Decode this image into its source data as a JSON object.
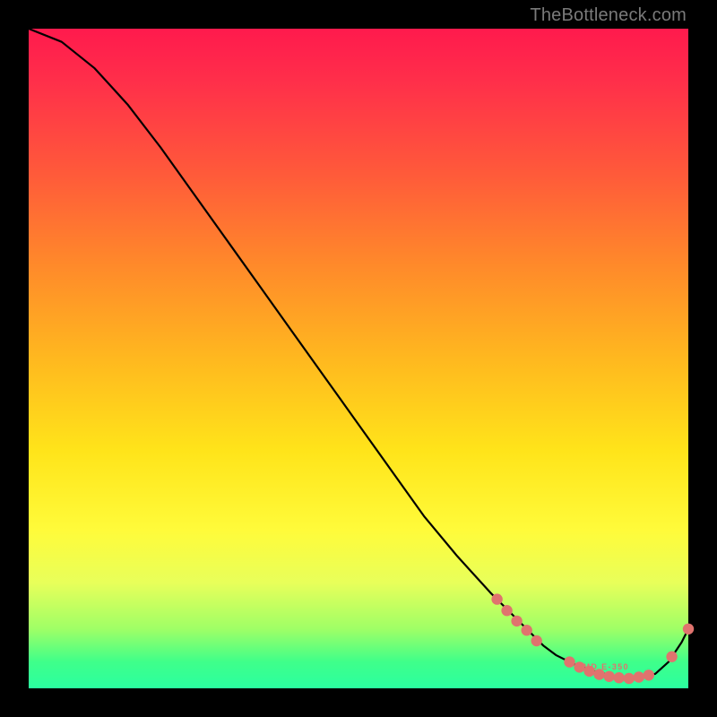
{
  "watermark": "TheBottleneck.com",
  "annotation_label": "AMD E-350",
  "chart_data": {
    "type": "line",
    "title": "",
    "xlabel": "",
    "ylabel": "",
    "xlim": [
      0,
      100
    ],
    "ylim": [
      0,
      100
    ],
    "series": [
      {
        "name": "bottleneck-curve",
        "x": [
          0,
          5,
          10,
          15,
          20,
          25,
          30,
          35,
          40,
          45,
          50,
          55,
          60,
          65,
          70,
          75,
          78,
          80,
          83,
          86,
          89,
          92,
          95,
          97,
          99,
          100
        ],
        "y": [
          100,
          98,
          94,
          88.5,
          82,
          75,
          68,
          61,
          54,
          47,
          40,
          33,
          26,
          20,
          14.5,
          9.5,
          6.5,
          5,
          3.5,
          2.5,
          1.8,
          1.5,
          2.2,
          4,
          7,
          9
        ]
      }
    ],
    "marker_cluster": {
      "comment": "salmon circle markers clustered near the valley",
      "points": [
        {
          "x": 71,
          "y": 13.5
        },
        {
          "x": 72.5,
          "y": 11.8
        },
        {
          "x": 74,
          "y": 10.2
        },
        {
          "x": 75.5,
          "y": 8.8
        },
        {
          "x": 77,
          "y": 7.2
        },
        {
          "x": 82,
          "y": 4.0
        },
        {
          "x": 83.5,
          "y": 3.2
        },
        {
          "x": 85,
          "y": 2.6
        },
        {
          "x": 86.5,
          "y": 2.1
        },
        {
          "x": 88,
          "y": 1.8
        },
        {
          "x": 89.5,
          "y": 1.6
        },
        {
          "x": 91,
          "y": 1.5
        },
        {
          "x": 92.5,
          "y": 1.7
        },
        {
          "x": 94,
          "y": 2.0
        },
        {
          "x": 97.5,
          "y": 4.8
        },
        {
          "x": 100,
          "y": 9.0
        }
      ]
    },
    "annotation": {
      "x": 87,
      "y": 3.2
    }
  }
}
